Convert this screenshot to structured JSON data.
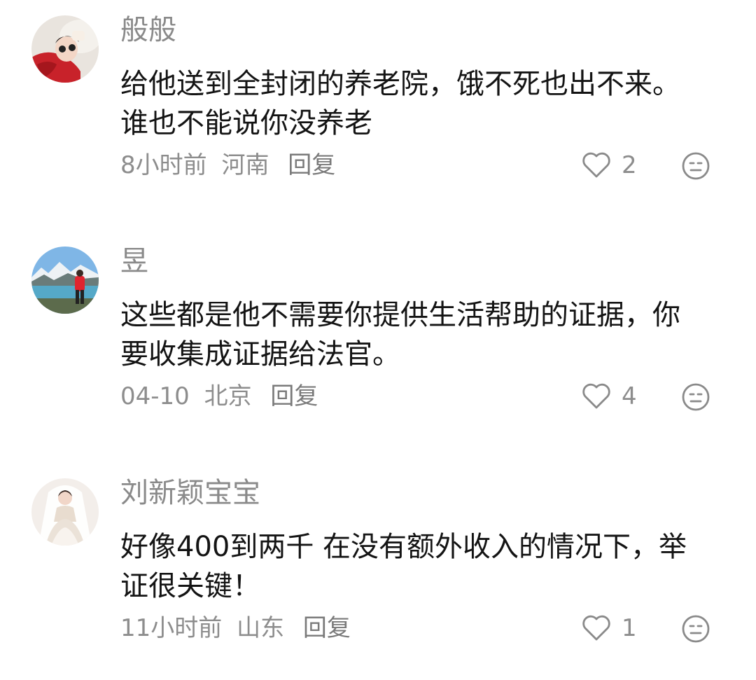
{
  "comments": [
    {
      "username": "般般",
      "content_lines": [
        "给他送到全封闭的养老院，饿不死也出不来。",
        "谁也不能说你没养老"
      ],
      "time": "8小时前",
      "location": "河南",
      "reply_label": "回复",
      "likes": "2",
      "avatar": "avatar-red-outfit"
    },
    {
      "username": "昱",
      "content_lines": [
        "这些都是他不需要你提供生活帮助的证据，你",
        "要收集成证据给法官。"
      ],
      "time": "04-10",
      "location": "北京",
      "reply_label": "回复",
      "likes": "4",
      "avatar": "avatar-mountain-lake"
    },
    {
      "username": "刘新颖宝宝",
      "content_lines": [
        "好像400到两千 在没有额外收入的情况下，举",
        "证很关键！"
      ],
      "time": "11小时前",
      "location": "山东",
      "reply_label": "回复",
      "likes": "1",
      "avatar": "avatar-bride"
    }
  ],
  "icons": {
    "like": "heart-outline-icon",
    "dislike": "neutral-face-icon"
  },
  "colors": {
    "text_primary": "#141414",
    "text_secondary": "#8d8d8d",
    "icon_gray": "#8a8a8a"
  }
}
